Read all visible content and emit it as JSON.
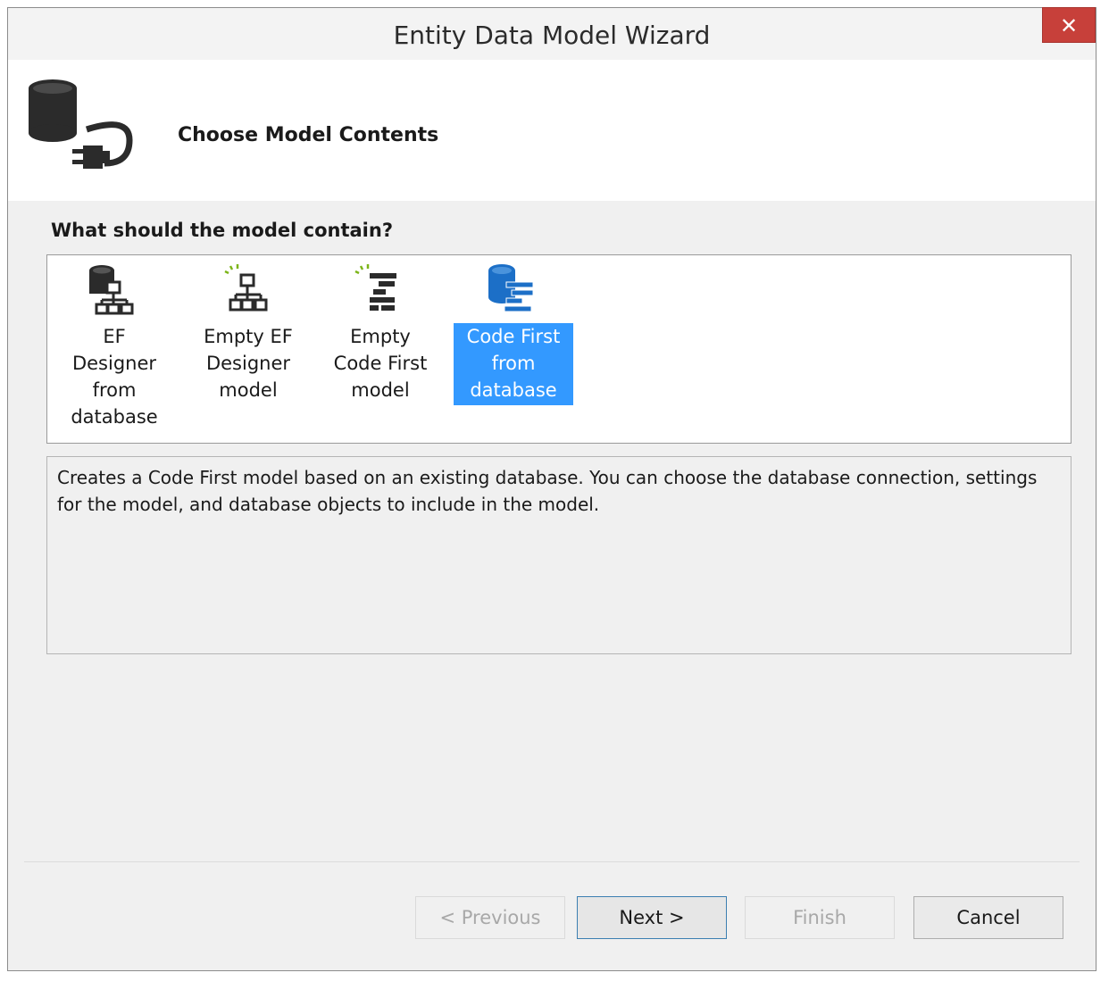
{
  "window": {
    "title": "Entity Data Model Wizard",
    "close_label": "✕"
  },
  "header": {
    "title": "Choose Model Contents",
    "icon": "database-plug-icon"
  },
  "question": "What should the model contain?",
  "choices": [
    {
      "label": "EF Designer from database",
      "icon": "ef-designer-database-icon",
      "selected": false
    },
    {
      "label": "Empty EF Designer model",
      "icon": "empty-ef-designer-icon",
      "selected": false
    },
    {
      "label": "Empty Code First model",
      "icon": "empty-code-first-icon",
      "selected": false
    },
    {
      "label": "Code First from database",
      "icon": "code-first-database-icon",
      "selected": true
    }
  ],
  "description": "Creates a Code First model based on an existing database. You can choose the database connection, settings for the model, and database objects to include in the model.",
  "buttons": {
    "previous": "< Previous",
    "next": "Next >",
    "finish": "Finish",
    "cancel": "Cancel"
  },
  "colors": {
    "selection": "#3399ff",
    "close": "#c7403a",
    "icon_dark": "#2b2b2b",
    "icon_blue": "#1c6fc7",
    "sparkle": "#7cb518"
  }
}
